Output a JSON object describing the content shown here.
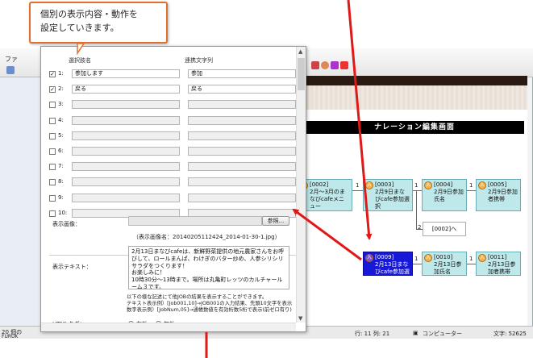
{
  "callout": {
    "line1": "個別の表示内容・動作を",
    "line2": "設定していきます。"
  },
  "background": {
    "left_toolbar_label": "ファ",
    "narration_title": "ナレーション編集画面",
    "status_left": "20 個の",
    "status_furuk": "FURUK",
    "status_middle": "行: 11   列: 21",
    "status_chars": "文字: 52625",
    "status_computer": "コンピューター",
    "nodes": [
      {
        "code": "[0002]",
        "text": "2月～3月のまなびcafeメニュー",
        "badge": "入"
      },
      {
        "code": "[0003]",
        "text": "2月9日まなびcafe参加選択",
        "badge": "入"
      },
      {
        "code": "[0004]",
        "text": "2月9日参加氏名",
        "badge": "入"
      },
      {
        "code": "[0005]",
        "text": "2月9日参加者携帯",
        "badge": "入"
      },
      {
        "code": "[0009]",
        "text": "2月13日まなびcafe参加選択",
        "badge": "入"
      },
      {
        "code": "[0010]",
        "text": "2月13日参加氏名",
        "badge": "入"
      },
      {
        "code": "[0011]",
        "text": "2月13日参加者携帯",
        "badge": "入"
      }
    ],
    "goto_box": "[0002]へ",
    "branch_numbers": [
      "1",
      "1",
      "1",
      "2",
      "1",
      "1"
    ]
  },
  "dialog": {
    "col_choice_header": "選択肢名",
    "col_link_header": "連携文字列",
    "choices": [
      {
        "index": "1:",
        "checked": true,
        "name": "参加します",
        "link": "参加"
      },
      {
        "index": "2:",
        "checked": true,
        "name": "戻る",
        "link": "戻る"
      },
      {
        "index": "3:",
        "checked": false,
        "name": "",
        "link": ""
      },
      {
        "index": "4:",
        "checked": false,
        "name": "",
        "link": ""
      },
      {
        "index": "5:",
        "checked": false,
        "name": "",
        "link": ""
      },
      {
        "index": "6:",
        "checked": false,
        "name": "",
        "link": ""
      },
      {
        "index": "7:",
        "checked": false,
        "name": "",
        "link": ""
      },
      {
        "index": "8:",
        "checked": false,
        "name": "",
        "link": ""
      },
      {
        "index": "9:",
        "checked": false,
        "name": "",
        "link": ""
      },
      {
        "index": "10:",
        "checked": false,
        "name": "",
        "link": ""
      }
    ],
    "image_label": "表示画像：",
    "browse_label": "参照...",
    "image_name": "（表示画像名：20140205112424_2014-01-30-1.jpg）",
    "text_label": "表示テキスト：",
    "text_lines": [
      "2月13日まなびcafeは、新鮮野菜提供の地元農家さんをお呼びして、ロールまんぱ、わけぎのバター炒め、人参シリシリサラダをつくります！",
      "お楽しみに！",
      "10時30分～13時まで。場所は丸亀町レッツのカルチャールーム３です。"
    ],
    "help_lines": [
      "以下の様な記述にて他JOBの結果を表示することができます。",
      "テキスト表示例）[Job001,10]→JOB001の入力結果、先頭10文字を表示",
      "数字表示例）[JobNum,05]→通帳数値を有効桁数5桁で表示(前ゼロ有り)"
    ],
    "html_tag_label": "HTMLタグ：",
    "html_on": "有効",
    "html_off": "無効"
  },
  "colors": {
    "callout_border": "#e07030",
    "arrow": "#e01818",
    "node_fill": "#bfe8ea",
    "node_selected": "#1818d8"
  }
}
